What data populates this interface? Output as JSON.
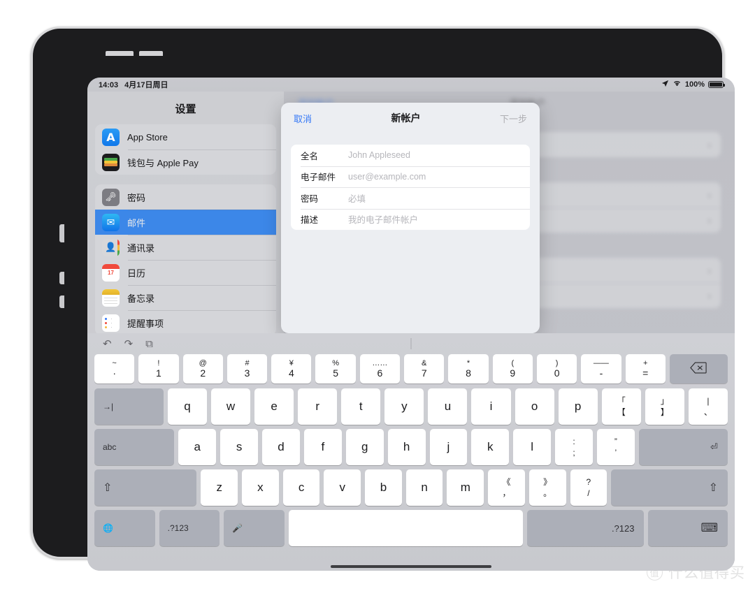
{
  "status_bar": {
    "time": "14:03",
    "date": "4月17日周日",
    "battery_percent": "100%",
    "icons": [
      "location-arrow-icon",
      "wifi-icon",
      "battery-icon"
    ]
  },
  "sidebar": {
    "title": "设置",
    "groups": [
      {
        "items": [
          {
            "label": "App Store",
            "icon": "app-store-icon",
            "selected": false
          },
          {
            "label": "钱包与 Apple Pay",
            "icon": "wallet-icon",
            "selected": false
          }
        ]
      },
      {
        "items": [
          {
            "label": "密码",
            "icon": "password-icon",
            "selected": false
          },
          {
            "label": "邮件",
            "icon": "mail-icon",
            "selected": true
          },
          {
            "label": "通讯录",
            "icon": "contacts-icon",
            "selected": false
          },
          {
            "label": "日历",
            "icon": "calendar-icon",
            "selected": false
          },
          {
            "label": "备忘录",
            "icon": "notes-icon",
            "selected": false
          },
          {
            "label": "提醒事项",
            "icon": "reminders-icon",
            "selected": false
          }
        ]
      }
    ]
  },
  "detail": {
    "back_label": "添加帐户",
    "title": "添加帐户",
    "rows_group_1": 1,
    "rows_group_2": 2,
    "rows_group_3": 2,
    "chevron": "›"
  },
  "modal": {
    "cancel_label": "取消",
    "title": "新帐户",
    "next_label": "下一步",
    "fields": [
      {
        "label": "全名",
        "value": "",
        "placeholder": "John Appleseed"
      },
      {
        "label": "电子邮件",
        "value": "",
        "placeholder": "user@example.com"
      },
      {
        "label": "密码",
        "value": "",
        "placeholder": "必填"
      },
      {
        "label": "描述",
        "value": "",
        "placeholder": "我的电子邮件帐户"
      }
    ]
  },
  "keyboard": {
    "toolbar": [
      {
        "name": "undo-icon",
        "glyph": "↶"
      },
      {
        "name": "redo-icon",
        "glyph": "↷"
      },
      {
        "name": "paste-icon",
        "glyph": "⧉"
      }
    ],
    "number_row": [
      {
        "sup": "~",
        "sub": "·"
      },
      {
        "sup": "!",
        "sub": "1"
      },
      {
        "sup": "@",
        "sub": "2"
      },
      {
        "sup": "#",
        "sub": "3"
      },
      {
        "sup": "¥",
        "sub": "4"
      },
      {
        "sup": "%",
        "sub": "5"
      },
      {
        "sup": "……",
        "sub": "6"
      },
      {
        "sup": "&",
        "sub": "7"
      },
      {
        "sup": "*",
        "sub": "8"
      },
      {
        "sup": "(",
        "sub": "9"
      },
      {
        "sup": ")",
        "sub": "0"
      },
      {
        "sup": "——",
        "sub": "-"
      },
      {
        "sup": "+",
        "sub": "="
      }
    ],
    "delete_label": "⌫",
    "tab_label": "→|",
    "row_q": [
      "q",
      "w",
      "e",
      "r",
      "t",
      "y",
      "u",
      "i",
      "o",
      "p"
    ],
    "row_q_punc": [
      {
        "sup": "「",
        "sub": "【"
      },
      {
        "sup": "」",
        "sub": "】"
      },
      {
        "sup": "|",
        "sub": "、"
      }
    ],
    "abc_label": "abc",
    "row_a": [
      "a",
      "s",
      "d",
      "f",
      "g",
      "h",
      "j",
      "k",
      "l"
    ],
    "row_a_punc": [
      {
        "sup": ":",
        "sub": ";"
      },
      {
        "sup": "”",
        "sub": "’"
      }
    ],
    "return_label": "⏎",
    "shift_label": "⇧",
    "row_z": [
      "z",
      "x",
      "c",
      "v",
      "b",
      "n",
      "m"
    ],
    "row_z_punc": [
      {
        "sup": "《",
        "sub": "，"
      },
      {
        "sup": "》",
        "sub": "。"
      },
      {
        "sup": "?",
        "sub": "/"
      }
    ],
    "globe_label": "🌐",
    "numeric_label": ".?123",
    "mic_label": "🎤",
    "space_label": "",
    "numeric_label_right": ".?123",
    "hide_keyboard_label": "⌨"
  },
  "watermark": {
    "logo": "值",
    "text": "什么值得买"
  },
  "colors": {
    "accent_blue": "#3478f6",
    "selected_row": "#3c87e8",
    "screen_bg": "#c3c4c9",
    "key_white": "#ffffff",
    "key_dark": "#acafb8"
  }
}
